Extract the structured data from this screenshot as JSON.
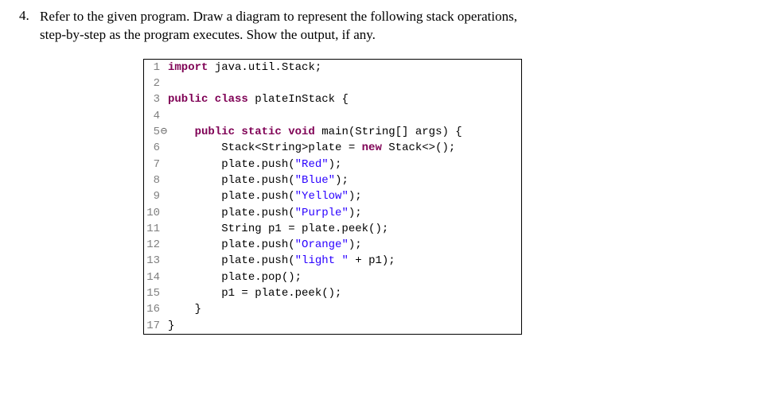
{
  "question": {
    "number": "4.",
    "text_line1": "Refer to the given program. Draw a diagram to represent the following stack operations,",
    "text_line2": "step-by-step as the program executes. Show the output, if any."
  },
  "code": {
    "lines": [
      {
        "n": "1",
        "marker": "",
        "tokens": [
          [
            "kw",
            "import"
          ],
          [
            "plain",
            " java.util.Stack;"
          ]
        ]
      },
      {
        "n": "2",
        "marker": "",
        "tokens": []
      },
      {
        "n": "3",
        "marker": "",
        "tokens": [
          [
            "kw",
            "public class"
          ],
          [
            "plain",
            " plateInStack {"
          ]
        ]
      },
      {
        "n": "4",
        "marker": "",
        "tokens": []
      },
      {
        "n": "5",
        "marker": "⊖",
        "tokens": [
          [
            "plain",
            "    "
          ],
          [
            "kw",
            "public static void"
          ],
          [
            "plain",
            " main(String[] args) {"
          ]
        ]
      },
      {
        "n": "6",
        "marker": "",
        "tokens": [
          [
            "plain",
            "        Stack<String>plate = "
          ],
          [
            "kw",
            "new"
          ],
          [
            "plain",
            " Stack<>();"
          ]
        ]
      },
      {
        "n": "7",
        "marker": "",
        "tokens": [
          [
            "plain",
            "        plate.push("
          ],
          [
            "str",
            "\"Red\""
          ],
          [
            "plain",
            ");"
          ]
        ]
      },
      {
        "n": "8",
        "marker": "",
        "tokens": [
          [
            "plain",
            "        plate.push("
          ],
          [
            "str",
            "\"Blue\""
          ],
          [
            "plain",
            ");"
          ]
        ]
      },
      {
        "n": "9",
        "marker": "",
        "tokens": [
          [
            "plain",
            "        plate.push("
          ],
          [
            "str",
            "\"Yellow\""
          ],
          [
            "plain",
            ");"
          ]
        ]
      },
      {
        "n": "10",
        "marker": "",
        "tokens": [
          [
            "plain",
            "        plate.push("
          ],
          [
            "str",
            "\"Purple\""
          ],
          [
            "plain",
            ");"
          ]
        ]
      },
      {
        "n": "11",
        "marker": "",
        "tokens": [
          [
            "plain",
            "        String p1 = plate.peek();"
          ]
        ]
      },
      {
        "n": "12",
        "marker": "",
        "tokens": [
          [
            "plain",
            "        plate.push("
          ],
          [
            "str",
            "\"Orange\""
          ],
          [
            "plain",
            ");"
          ]
        ]
      },
      {
        "n": "13",
        "marker": "",
        "tokens": [
          [
            "plain",
            "        plate.push("
          ],
          [
            "str",
            "\"light \""
          ],
          [
            "plain",
            " + p1);"
          ]
        ]
      },
      {
        "n": "14",
        "marker": "",
        "tokens": [
          [
            "plain",
            "        plate.pop();"
          ]
        ]
      },
      {
        "n": "15",
        "marker": "",
        "tokens": [
          [
            "plain",
            "        p1 = plate.peek();"
          ]
        ]
      },
      {
        "n": "16",
        "marker": "",
        "tokens": [
          [
            "plain",
            "    }"
          ]
        ]
      },
      {
        "n": "17",
        "marker": "",
        "tokens": [
          [
            "plain",
            "}"
          ]
        ]
      }
    ]
  }
}
